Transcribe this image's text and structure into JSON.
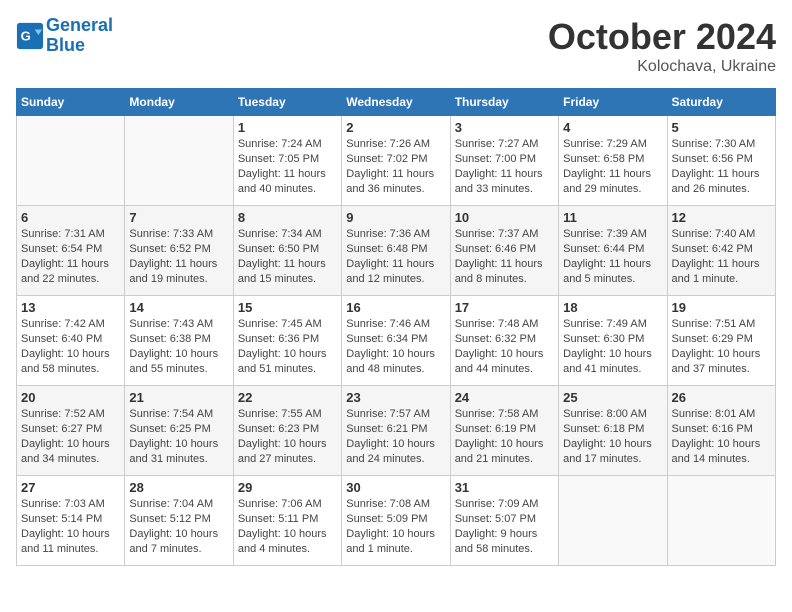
{
  "header": {
    "logo_line1": "General",
    "logo_line2": "Blue",
    "month": "October 2024",
    "location": "Kolochava, Ukraine"
  },
  "weekdays": [
    "Sunday",
    "Monday",
    "Tuesday",
    "Wednesday",
    "Thursday",
    "Friday",
    "Saturday"
  ],
  "weeks": [
    [
      {
        "day": "",
        "info": ""
      },
      {
        "day": "",
        "info": ""
      },
      {
        "day": "1",
        "info": "Sunrise: 7:24 AM\nSunset: 7:05 PM\nDaylight: 11 hours and 40 minutes."
      },
      {
        "day": "2",
        "info": "Sunrise: 7:26 AM\nSunset: 7:02 PM\nDaylight: 11 hours and 36 minutes."
      },
      {
        "day": "3",
        "info": "Sunrise: 7:27 AM\nSunset: 7:00 PM\nDaylight: 11 hours and 33 minutes."
      },
      {
        "day": "4",
        "info": "Sunrise: 7:29 AM\nSunset: 6:58 PM\nDaylight: 11 hours and 29 minutes."
      },
      {
        "day": "5",
        "info": "Sunrise: 7:30 AM\nSunset: 6:56 PM\nDaylight: 11 hours and 26 minutes."
      }
    ],
    [
      {
        "day": "6",
        "info": "Sunrise: 7:31 AM\nSunset: 6:54 PM\nDaylight: 11 hours and 22 minutes."
      },
      {
        "day": "7",
        "info": "Sunrise: 7:33 AM\nSunset: 6:52 PM\nDaylight: 11 hours and 19 minutes."
      },
      {
        "day": "8",
        "info": "Sunrise: 7:34 AM\nSunset: 6:50 PM\nDaylight: 11 hours and 15 minutes."
      },
      {
        "day": "9",
        "info": "Sunrise: 7:36 AM\nSunset: 6:48 PM\nDaylight: 11 hours and 12 minutes."
      },
      {
        "day": "10",
        "info": "Sunrise: 7:37 AM\nSunset: 6:46 PM\nDaylight: 11 hours and 8 minutes."
      },
      {
        "day": "11",
        "info": "Sunrise: 7:39 AM\nSunset: 6:44 PM\nDaylight: 11 hours and 5 minutes."
      },
      {
        "day": "12",
        "info": "Sunrise: 7:40 AM\nSunset: 6:42 PM\nDaylight: 11 hours and 1 minute."
      }
    ],
    [
      {
        "day": "13",
        "info": "Sunrise: 7:42 AM\nSunset: 6:40 PM\nDaylight: 10 hours and 58 minutes."
      },
      {
        "day": "14",
        "info": "Sunrise: 7:43 AM\nSunset: 6:38 PM\nDaylight: 10 hours and 55 minutes."
      },
      {
        "day": "15",
        "info": "Sunrise: 7:45 AM\nSunset: 6:36 PM\nDaylight: 10 hours and 51 minutes."
      },
      {
        "day": "16",
        "info": "Sunrise: 7:46 AM\nSunset: 6:34 PM\nDaylight: 10 hours and 48 minutes."
      },
      {
        "day": "17",
        "info": "Sunrise: 7:48 AM\nSunset: 6:32 PM\nDaylight: 10 hours and 44 minutes."
      },
      {
        "day": "18",
        "info": "Sunrise: 7:49 AM\nSunset: 6:30 PM\nDaylight: 10 hours and 41 minutes."
      },
      {
        "day": "19",
        "info": "Sunrise: 7:51 AM\nSunset: 6:29 PM\nDaylight: 10 hours and 37 minutes."
      }
    ],
    [
      {
        "day": "20",
        "info": "Sunrise: 7:52 AM\nSunset: 6:27 PM\nDaylight: 10 hours and 34 minutes."
      },
      {
        "day": "21",
        "info": "Sunrise: 7:54 AM\nSunset: 6:25 PM\nDaylight: 10 hours and 31 minutes."
      },
      {
        "day": "22",
        "info": "Sunrise: 7:55 AM\nSunset: 6:23 PM\nDaylight: 10 hours and 27 minutes."
      },
      {
        "day": "23",
        "info": "Sunrise: 7:57 AM\nSunset: 6:21 PM\nDaylight: 10 hours and 24 minutes."
      },
      {
        "day": "24",
        "info": "Sunrise: 7:58 AM\nSunset: 6:19 PM\nDaylight: 10 hours and 21 minutes."
      },
      {
        "day": "25",
        "info": "Sunrise: 8:00 AM\nSunset: 6:18 PM\nDaylight: 10 hours and 17 minutes."
      },
      {
        "day": "26",
        "info": "Sunrise: 8:01 AM\nSunset: 6:16 PM\nDaylight: 10 hours and 14 minutes."
      }
    ],
    [
      {
        "day": "27",
        "info": "Sunrise: 7:03 AM\nSunset: 5:14 PM\nDaylight: 10 hours and 11 minutes."
      },
      {
        "day": "28",
        "info": "Sunrise: 7:04 AM\nSunset: 5:12 PM\nDaylight: 10 hours and 7 minutes."
      },
      {
        "day": "29",
        "info": "Sunrise: 7:06 AM\nSunset: 5:11 PM\nDaylight: 10 hours and 4 minutes."
      },
      {
        "day": "30",
        "info": "Sunrise: 7:08 AM\nSunset: 5:09 PM\nDaylight: 10 hours and 1 minute."
      },
      {
        "day": "31",
        "info": "Sunrise: 7:09 AM\nSunset: 5:07 PM\nDaylight: 9 hours and 58 minutes."
      },
      {
        "day": "",
        "info": ""
      },
      {
        "day": "",
        "info": ""
      }
    ]
  ]
}
